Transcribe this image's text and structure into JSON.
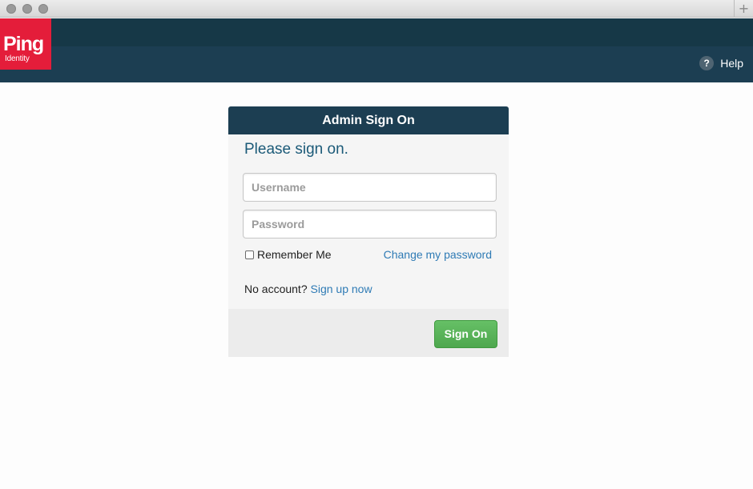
{
  "window": {
    "new_tab_glyph": "+"
  },
  "brand": {
    "logo_text": "Ping",
    "logo_subtext": "Identity",
    "color": "#e41d3a"
  },
  "header": {
    "help_icon": "?",
    "help_label": "Help",
    "bar_color": "#1c3e52"
  },
  "card": {
    "title": "Admin Sign On",
    "prompt": "Please sign on.",
    "username_placeholder": "Username",
    "password_placeholder": "Password",
    "remember_label": "Remember Me",
    "remember_checked": false,
    "change_password_label": "Change my password",
    "no_account_text": "No account?",
    "signup_label": "Sign up now",
    "signon_label": "Sign On",
    "accent_link": "#2f7bb5",
    "button_color": "#56b056"
  },
  "icons": {
    "window_controls": "traffic-light-dots",
    "help": "question-circle-icon"
  }
}
